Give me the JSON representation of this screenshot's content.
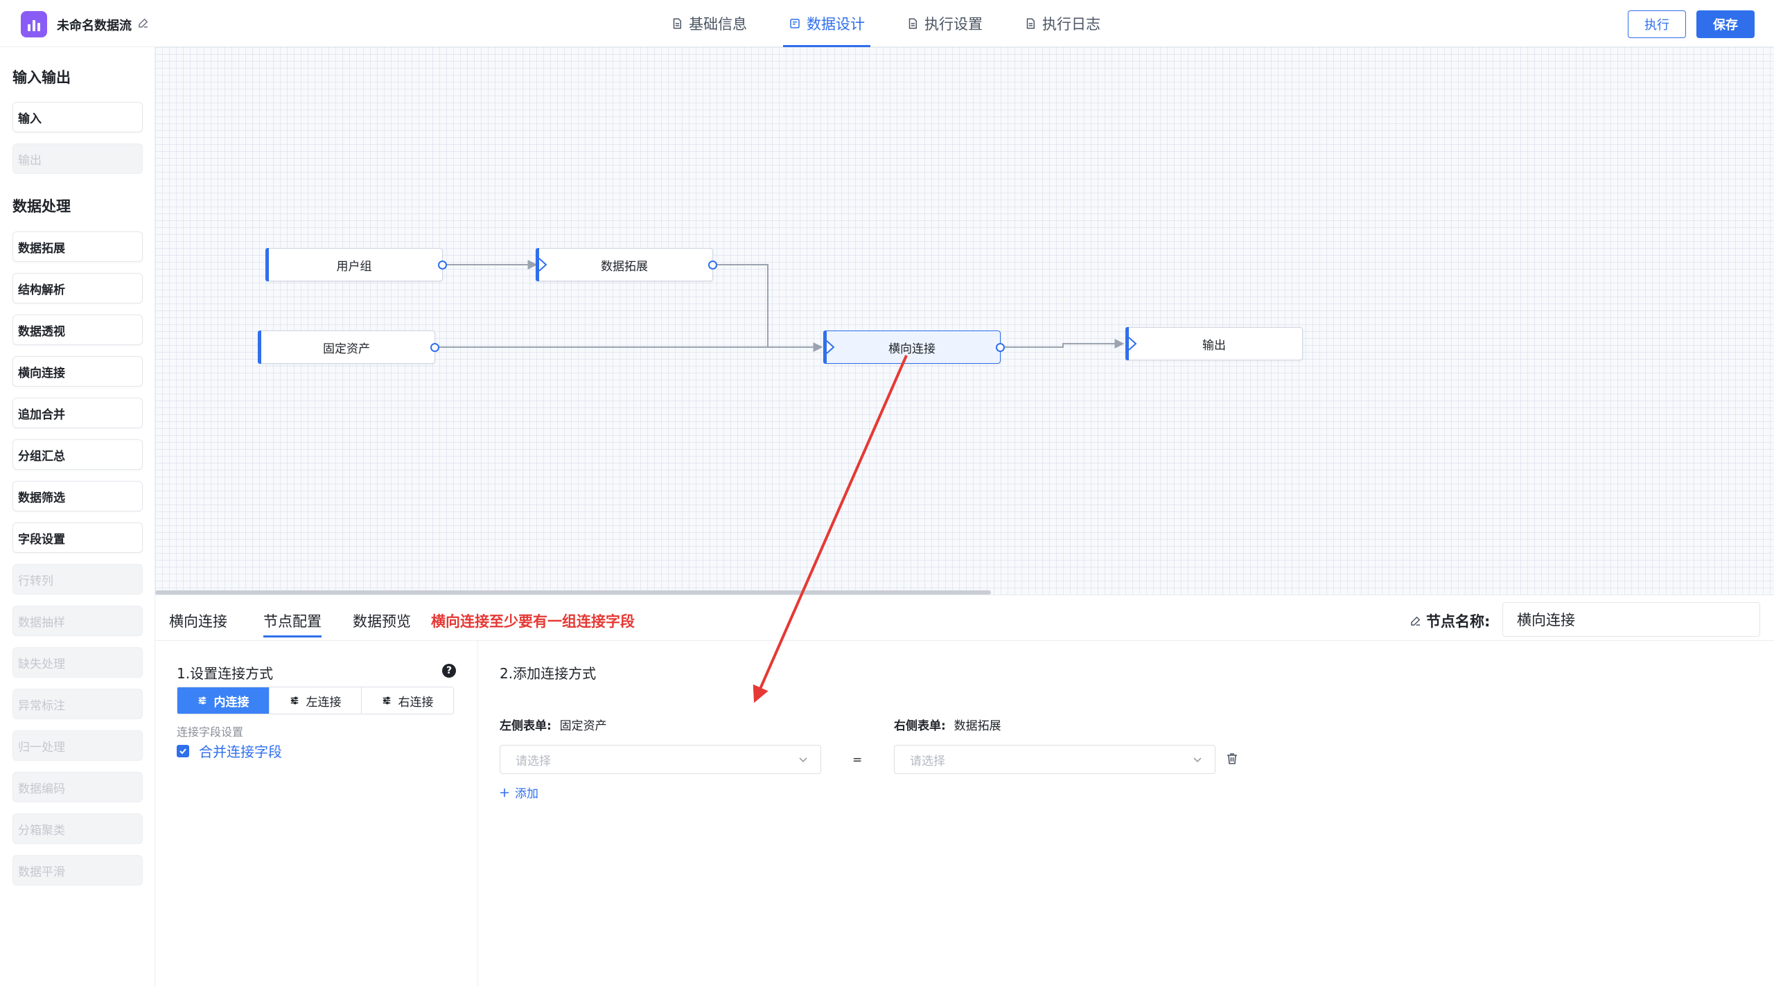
{
  "header": {
    "app_title": "未命名数据流",
    "tabs": [
      {
        "label": "基础信息"
      },
      {
        "label": "数据设计"
      },
      {
        "label": "执行设置"
      },
      {
        "label": "执行日志"
      }
    ],
    "active_tab": "数据设计",
    "exec_label": "执行",
    "save_label": "保存"
  },
  "sidebar": {
    "io_title": "输入输出",
    "io_items": [
      {
        "label": "输入",
        "disabled": false
      },
      {
        "label": "输出",
        "disabled": true
      }
    ],
    "proc_title": "数据处理",
    "proc_items": [
      {
        "label": "数据拓展",
        "disabled": false
      },
      {
        "label": "结构解析",
        "disabled": false
      },
      {
        "label": "数据透视",
        "disabled": false
      },
      {
        "label": "横向连接",
        "disabled": false
      },
      {
        "label": "追加合并",
        "disabled": false
      },
      {
        "label": "分组汇总",
        "disabled": false
      },
      {
        "label": "数据筛选",
        "disabled": false
      },
      {
        "label": "字段设置",
        "disabled": false
      },
      {
        "label": "行转列",
        "disabled": true
      },
      {
        "label": "数据抽样",
        "disabled": true
      },
      {
        "label": "缺失处理",
        "disabled": true
      },
      {
        "label": "异常标注",
        "disabled": true
      },
      {
        "label": "归一处理",
        "disabled": true
      },
      {
        "label": "数据编码",
        "disabled": true
      },
      {
        "label": "分箱聚类",
        "disabled": true
      },
      {
        "label": "数据平滑",
        "disabled": true
      }
    ]
  },
  "canvas": {
    "nodes": [
      {
        "id": "user_group",
        "label": "用户组"
      },
      {
        "id": "data_expand",
        "label": "数据拓展"
      },
      {
        "id": "fixed_assets",
        "label": "固定资产"
      },
      {
        "id": "horizontal_join",
        "label": "横向连接",
        "selected": true
      },
      {
        "id": "output",
        "label": "输出"
      }
    ]
  },
  "panel": {
    "tabs": [
      {
        "label": "横向连接"
      },
      {
        "label": "节点配置"
      },
      {
        "label": "数据预览"
      }
    ],
    "active_tab": "节点配置",
    "error_text": "横向连接至少要有一组连接字段",
    "node_name_label": "节点名称:",
    "node_name_value": "横向连接",
    "left": {
      "title": "1.设置连接方式",
      "join_types": [
        {
          "label": "内连接",
          "active": true
        },
        {
          "label": "左连接",
          "active": false
        },
        {
          "label": "右连接",
          "active": false
        }
      ],
      "field_label": "连接字段设置",
      "merge_checkbox_label": "合并连接字段",
      "merge_checked": true
    },
    "right": {
      "title": "2.添加连接方式",
      "left_table_label": "左侧表单:",
      "left_table_value": "固定资产",
      "right_table_label": "右侧表单:",
      "right_table_value": "数据拓展",
      "left_select_placeholder": "请选择",
      "right_select_placeholder": "请选择",
      "equals": "=",
      "add_label": "添加"
    }
  },
  "colors": {
    "accent": "#2f6fec",
    "error": "#e53935",
    "annotation_arrow": "#e53935"
  }
}
